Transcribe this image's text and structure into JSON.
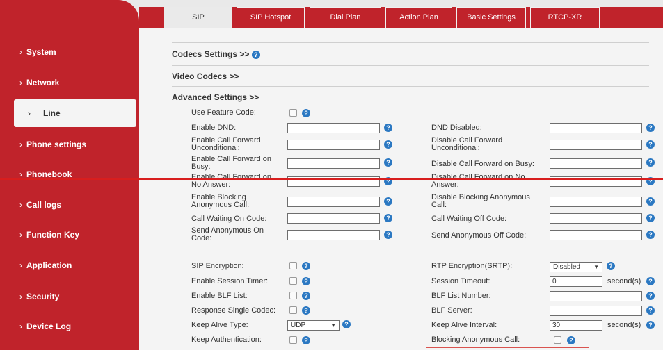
{
  "tabs": [
    "SIP",
    "SIP Hotspot",
    "Dial Plan",
    "Action Plan",
    "Basic Settings",
    "RTCP-XR"
  ],
  "sidebar": {
    "chevron": "›",
    "items": [
      "System",
      "Network",
      "Line",
      "Phone settings",
      "Phonebook",
      "Call logs",
      "Function Key",
      "Application",
      "Security",
      "Device Log"
    ]
  },
  "sections": {
    "codecs": "Codecs Settings >>",
    "video": "Video Codecs >>",
    "advanced": "Advanced Settings >>"
  },
  "help_glyph": "?",
  "fields": {
    "use_feature_code": "Use Feature Code:",
    "enable_dnd": "Enable DND:",
    "dnd_disabled": "DND Disabled:",
    "enable_cfu": "Enable Call Forward Unconditional:",
    "disable_cfu": "Disable Call Forward Unconditional:",
    "enable_cfb": "Enable Call Forward on Busy:",
    "disable_cfb": "Disable Call Forward on Busy:",
    "enable_cfna": "Enable Call Forward on No Answer:",
    "disable_cfna": "Disable Call Forward on No Answer:",
    "enable_block_anon": "Enable Blocking Anonymous Call:",
    "disable_block_anon": "Disable Blocking Anonymous Call:",
    "cw_on": "Call Waiting On Code:",
    "cw_off": "Call Waiting Off Code:",
    "send_anon_on": "Send Anonymous On Code:",
    "send_anon_off": "Send Anonymous Off Code:",
    "sip_encryption": "SIP Encryption:",
    "rtp_encryption": "RTP Encryption(SRTP):",
    "session_timer": "Enable Session Timer:",
    "session_timeout": "Session Timeout:",
    "blf_list": "Enable BLF List:",
    "blf_number": "BLF List Number:",
    "single_codec": "Response Single Codec:",
    "blf_server": "BLF Server:",
    "keepalive_type": "Keep Alive Type:",
    "keepalive_interval": "Keep Alive Interval:",
    "keep_auth": "Keep Authentication:",
    "blocking_anon": "Blocking Anonymous Call:"
  },
  "values": {
    "rtp_encryption": "Disabled",
    "session_timeout": "0",
    "keepalive_type": "UDP",
    "keepalive_interval": "30",
    "seconds_unit": "second(s)",
    "dropdown_arrow": "▼"
  }
}
